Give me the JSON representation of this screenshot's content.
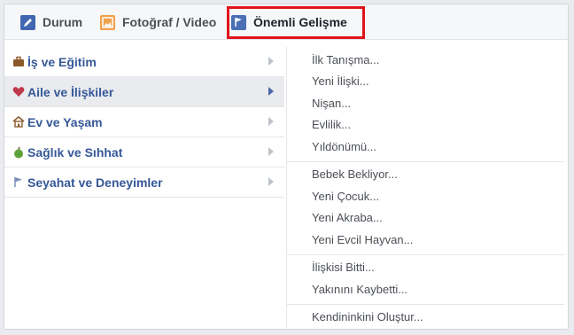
{
  "tabs": {
    "status_label": "Durum",
    "photo_label": "Fotoğraf / Video",
    "life_event_label": "Önemli Gelişme"
  },
  "categories": [
    {
      "label": "İş ve Eğitim",
      "icon": "briefcase-icon"
    },
    {
      "label": "Aile ve İlişkiler",
      "icon": "heart-icon"
    },
    {
      "label": "Ev ve Yaşam",
      "icon": "house-icon"
    },
    {
      "label": "Sağlık ve Sıhhat",
      "icon": "apple-icon"
    },
    {
      "label": "Seyahat ve Deneyimler",
      "icon": "flag-icon"
    }
  ],
  "active_category": "Aile ve İlişkiler",
  "subgroups": [
    [
      "İlk Tanışma...",
      "Yeni İlişki...",
      "Nişan...",
      "Evlilik...",
      "Yıldönümü..."
    ],
    [
      "Bebek Bekliyor...",
      "Yeni Çocuk...",
      "Yeni Akraba...",
      "Yeni Evcil Hayvan..."
    ],
    [
      "İlişkisi Bitti...",
      "Yakınını Kaybetti..."
    ],
    [
      "Kendininkini Oluştur..."
    ]
  ],
  "colors": {
    "highlight_box": "#e0141e",
    "link_blue": "#365899",
    "active_row_bg": "#e9ebee"
  }
}
